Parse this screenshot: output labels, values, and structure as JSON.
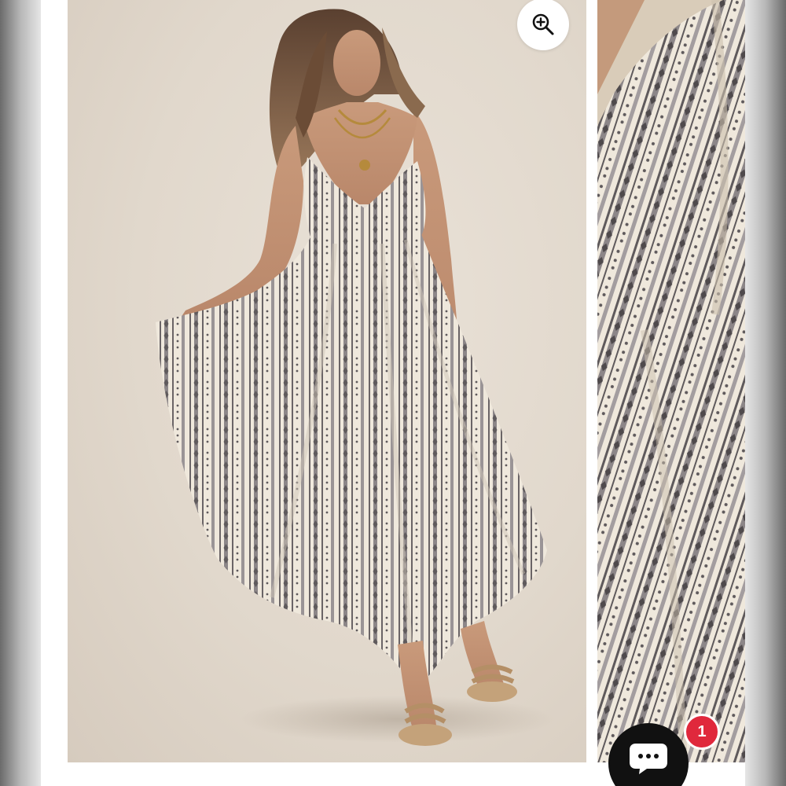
{
  "listing": {
    "images": [
      {
        "name": "halter-maxi-dress-front"
      },
      {
        "name": "halter-maxi-dress-fabric-detail"
      }
    ]
  },
  "controls": {
    "zoom_icon": "zoom-in-icon",
    "chat_icon": "chat-bubble-icon"
  },
  "notifications": {
    "badge_count": "1"
  },
  "colors": {
    "badge": "#e0283c",
    "chat_button": "#111111",
    "photo_background": "#e1d8cc",
    "fabric_stripe": "#5f5a5c",
    "fabric_base": "#efe8dc"
  }
}
